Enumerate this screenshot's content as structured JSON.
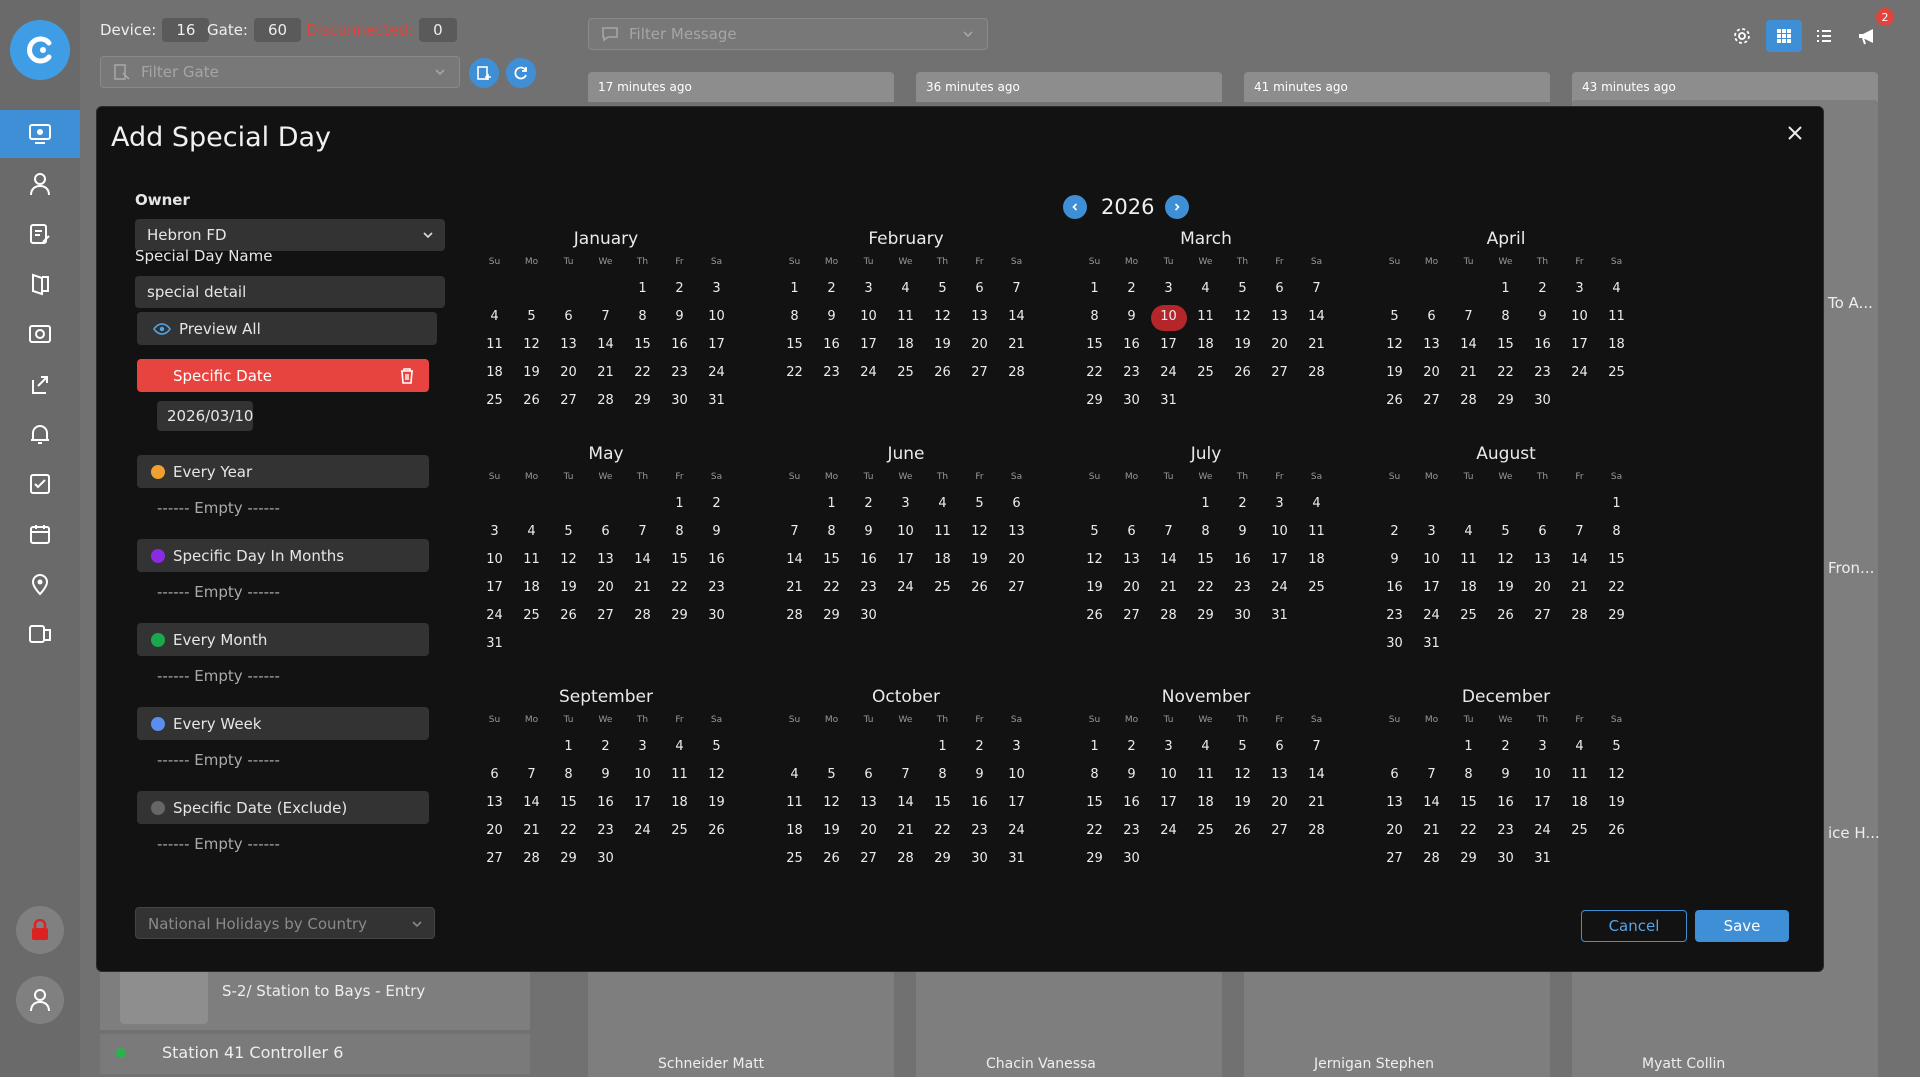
{
  "header": {
    "device_label": "Device:",
    "device_count": "16",
    "gate_label": "Gate:",
    "gate_count": "60",
    "disconnected_label": "Disconnected:",
    "disconnected_count": "0",
    "filter_gate_placeholder": "Filter Gate",
    "filter_message_placeholder": "Filter Message",
    "notification_count": "2"
  },
  "cards": [
    {
      "time": "17 minutes ago"
    },
    {
      "time": "36 minutes ago"
    },
    {
      "time": "41 minutes ago"
    },
    {
      "time": "43 minutes ago"
    }
  ],
  "background_text": {
    "peek1": "To A...",
    "peek2": "Fron...",
    "peek3": "ice H...",
    "gate_item": "S-2/ Station to Bays - Entry",
    "controller": "Station 41 Controller 6",
    "names": [
      "Schneider Matt",
      "Chacin Vanessa",
      "Jernigan Stephen",
      "Myatt Collin"
    ]
  },
  "modal": {
    "title": "Add Special Day",
    "owner_label": "Owner",
    "owner_value": "Hebron FD",
    "name_label": "Special Day Name",
    "name_value": "special detail",
    "preview_label": "Preview All",
    "empty_text": "------ Empty ------",
    "rules": [
      {
        "label": "Specific Date",
        "color": "#e8443f",
        "dates": [
          "2026/03/10"
        ]
      },
      {
        "label": "Every Year",
        "color": "#f0a030",
        "dates": []
      },
      {
        "label": "Specific Day In Months",
        "color": "#8a2be2",
        "dates": []
      },
      {
        "label": "Every Month",
        "color": "#1aa84a",
        "dates": []
      },
      {
        "label": "Every Week",
        "color": "#5b8def",
        "dates": []
      },
      {
        "label": "Specific Date (Exclude)",
        "color": "#666666",
        "dates": []
      }
    ],
    "holiday_placeholder": "National Holidays by Country",
    "cancel_label": "Cancel",
    "save_label": "Save"
  },
  "calendar": {
    "year": "2026",
    "weekday_labels": [
      "Su",
      "Mo",
      "Tu",
      "We",
      "Th",
      "Fr",
      "Sa"
    ],
    "months": [
      {
        "name": "January",
        "first_weekday": 4,
        "days": 31
      },
      {
        "name": "February",
        "first_weekday": 0,
        "days": 28
      },
      {
        "name": "March",
        "first_weekday": 0,
        "days": 31
      },
      {
        "name": "April",
        "first_weekday": 3,
        "days": 30
      },
      {
        "name": "May",
        "first_weekday": 5,
        "days": 31
      },
      {
        "name": "June",
        "first_weekday": 1,
        "days": 30
      },
      {
        "name": "July",
        "first_weekday": 3,
        "days": 31
      },
      {
        "name": "August",
        "first_weekday": 6,
        "days": 31
      },
      {
        "name": "September",
        "first_weekday": 2,
        "days": 30
      },
      {
        "name": "October",
        "first_weekday": 4,
        "days": 31
      },
      {
        "name": "November",
        "first_weekday": 0,
        "days": 30
      },
      {
        "name": "December",
        "first_weekday": 2,
        "days": 31
      }
    ],
    "selected": [
      {
        "month": 3,
        "day": 10
      }
    ]
  },
  "colors": {
    "accent": "#3f8fd6",
    "danger": "#e8443f",
    "selected_day": "#b5262b"
  },
  "icons": {
    "sidebar": [
      "monitor-icon",
      "user-icon",
      "edit-list-icon",
      "door-icon",
      "camera-icon",
      "export-icon",
      "bell-icon",
      "checklist-icon",
      "calendar-icon",
      "location-icon",
      "id-card-icon"
    ]
  }
}
